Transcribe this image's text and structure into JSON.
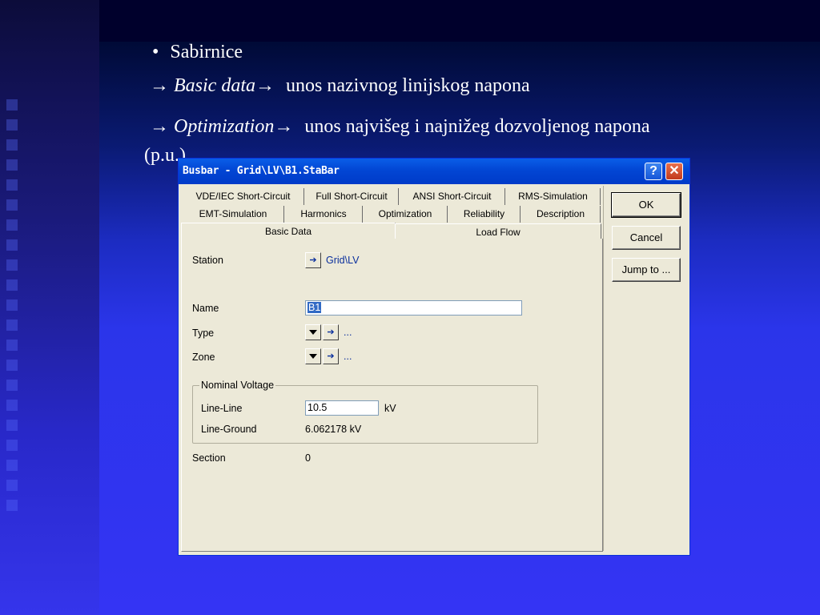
{
  "slide": {
    "bullet": "•",
    "line1": "Sabirnice",
    "line2_arrow1": "→",
    "line2_term": "Basic data",
    "line2_arrow2": "→",
    "line2_rest": "unos nazivnog linijskog napona",
    "line3_arrow1": "→",
    "line3_term": "Optimization",
    "line3_arrow2": "→",
    "line3_rest": "unos najvišeg i najnižeg dozvoljenog napona",
    "line4": "(p.u.)"
  },
  "dialog": {
    "title": "Busbar - Grid\\LV\\B1.StaBar",
    "help_glyph": "?",
    "close_glyph": "✕",
    "tabs_row1": [
      "VDE/IEC Short-Circuit",
      "Full Short-Circuit",
      "ANSI Short-Circuit",
      "RMS-Simulation"
    ],
    "tabs_row2": [
      "EMT-Simulation",
      "Harmonics",
      "Optimization",
      "Reliability",
      "Description"
    ],
    "tabs_row3": [
      "Basic Data",
      "Load Flow"
    ],
    "buttons": {
      "ok": "OK",
      "cancel": "Cancel",
      "jump": "Jump to ..."
    },
    "fields": {
      "station_label": "Station",
      "station_value": "Grid\\LV",
      "name_label": "Name",
      "name_value": "B1",
      "type_label": "Type",
      "type_value": "...",
      "zone_label": "Zone",
      "zone_value": "...",
      "group_title": "Nominal Voltage",
      "ll_label": "Line-Line",
      "ll_value": "10.5",
      "ll_unit": "kV",
      "lg_label": "Line-Ground",
      "lg_value": "6.062178 kV",
      "section_label": "Section",
      "section_value": "0"
    },
    "icons": {
      "jump_arrow": "jump-arrow-icon",
      "dropdown": "dropdown-icon"
    }
  }
}
